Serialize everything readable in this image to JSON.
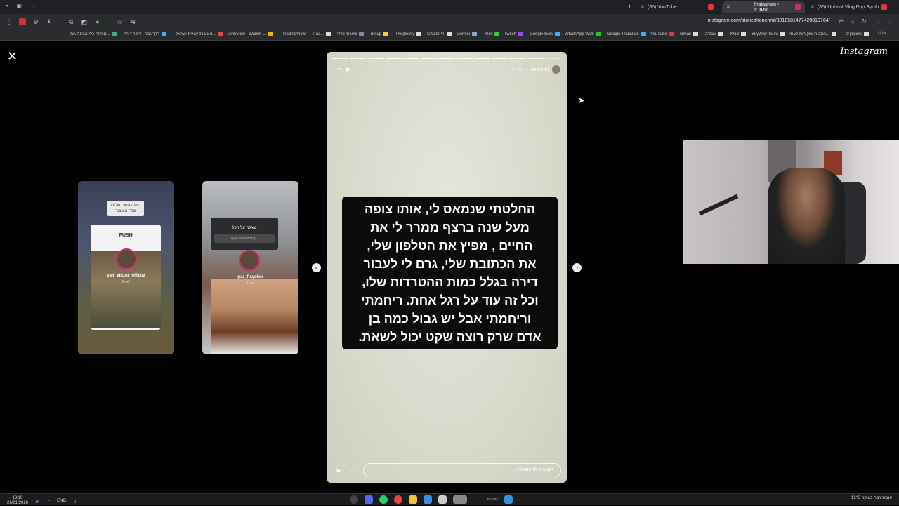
{
  "browser": {
    "tabs": [
      {
        "label": "(36) YouTube",
        "active": false
      },
      {
        "label": "Instagram • סטוריז",
        "active": true
      },
      {
        "label": "(35) Upbeat Vlog Pop Synth",
        "active": false
      }
    ],
    "url": "instagram.com/stories/ronenml/3818581477420819764/",
    "bookmarks": [
      "נוכלות כלי הבינה הת...",
      "דרך גבר - דיפר דורה",
      "אוניברסיטאית ישראל...",
      "Overview - Wallet -...",
      "TradingView — Trac...",
      "שערוך כללי",
      "meup",
      "Perplexity",
      "ChatGPT",
      "Gemini",
      "Kick",
      "Twitch",
      "Google חנות",
      "WhatsApp Web",
      "Google Translate",
      "YouTube",
      "Gmail",
      "עבודה",
      "KGZ",
      "SkyWay Tours",
      "כתבות ומקורות לעתי...",
      "השומקים",
      "כללי"
    ]
  },
  "instagram": {
    "logo": "Instagram",
    "previews": [
      {
        "username": "yair_elitzur_official",
        "time": "9 שע'",
        "header": "תהיה השם שלום ומדי הציבור",
        "badge": "PUSH"
      },
      {
        "username": "paz_flaysher",
        "time": "4 שע'",
        "question": "שאלה על הכל",
        "input_placeholder": "Type something..."
      }
    ],
    "story": {
      "username": "ronenml",
      "time": "4 שע'",
      "progress_total": 13,
      "progress_done": 12,
      "text": "החלטתי  שנמאס לי, אותו צופה\nמעל שנה ברצף ממרר לי את\nהחיים , מפיץ את הטלפון שלי,\nאת הכתובת שלי, גרם לי לעבור\nדירה בגלל כמות ההטרדות שלו,\nוכל זה עוד על רגל אחת. ריחמתי\nוריחמתי אבל יש גבול כמה בן\nאדם שרק רוצה שקט יכול לשאת.",
      "reply_placeholder": "תשובה לronenml..."
    }
  },
  "taskbar": {
    "time": "19:10",
    "date": "26/01/2026",
    "lang": "ENG",
    "search_label": "חיפוש",
    "weather": "13°C",
    "weather_desc": "עננות רבה בעיקר"
  }
}
